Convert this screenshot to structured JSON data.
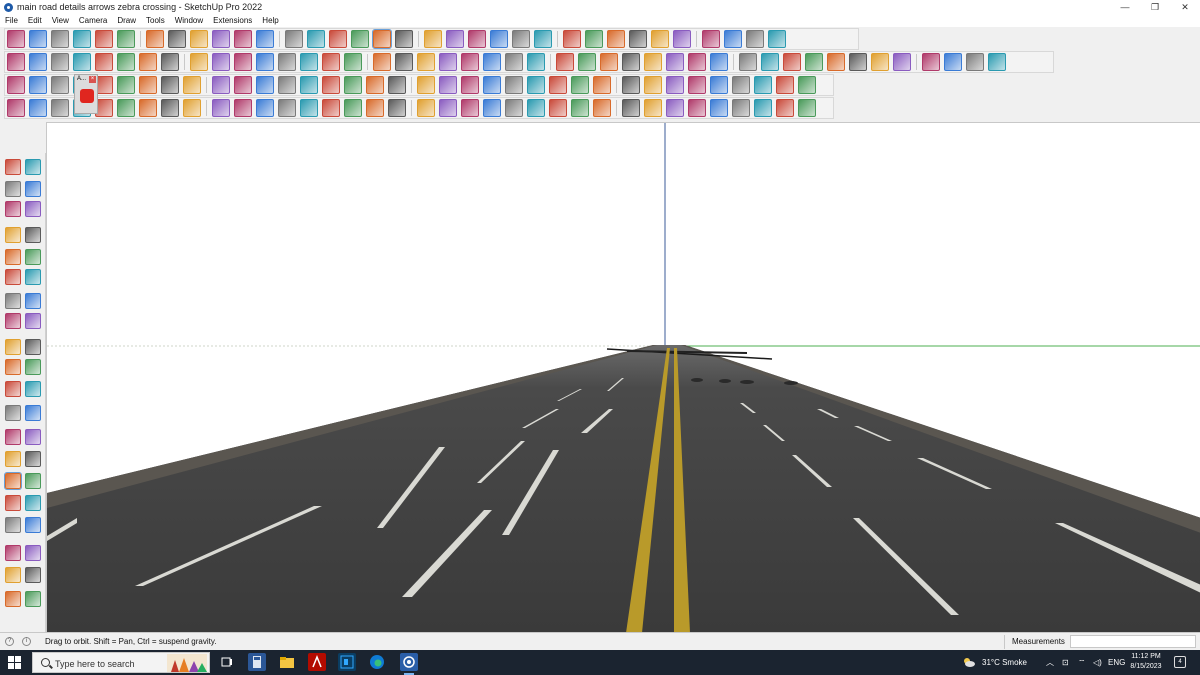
{
  "window": {
    "title": "main road details arrows zebra crossing - SketchUp Pro 2022",
    "minimize_glyph": "—",
    "restore_glyph": "❐",
    "close_glyph": "✕"
  },
  "menu": {
    "items": [
      "File",
      "Edit",
      "View",
      "Camera",
      "Draw",
      "Tools",
      "Window",
      "Extensions",
      "Help"
    ]
  },
  "toolbar": {
    "tooltip_label": "A..."
  },
  "status": {
    "message": "Drag to orbit. Shift = Pan, Ctrl = suspend gravity.",
    "info_glyph_1": "?",
    "info_glyph_2": "i",
    "measurements_label": "Measurements",
    "measurements_value": ""
  },
  "taskbar": {
    "search_placeholder": "Type here to search",
    "weather": "31°C  Smoke",
    "language": "ENG",
    "time": "11:12 PM",
    "date": "8/15/2023",
    "notification_count": "4",
    "apps": [
      "task-view",
      "calculator",
      "file-explorer",
      "acrobat",
      "photoshop",
      "edge",
      "sketchup"
    ]
  },
  "colors": {
    "road_asphalt": "#3d3d3d",
    "road_shoulder": "#5a5650",
    "lane_marking": "#e6e6e0",
    "center_line": "#b99a2a",
    "axis_green": "#4caf50",
    "axis_blue": "#3b5b9a",
    "taskbar_bg": "#1b2430",
    "selected_tool_highlight": "#cfe3f7"
  }
}
